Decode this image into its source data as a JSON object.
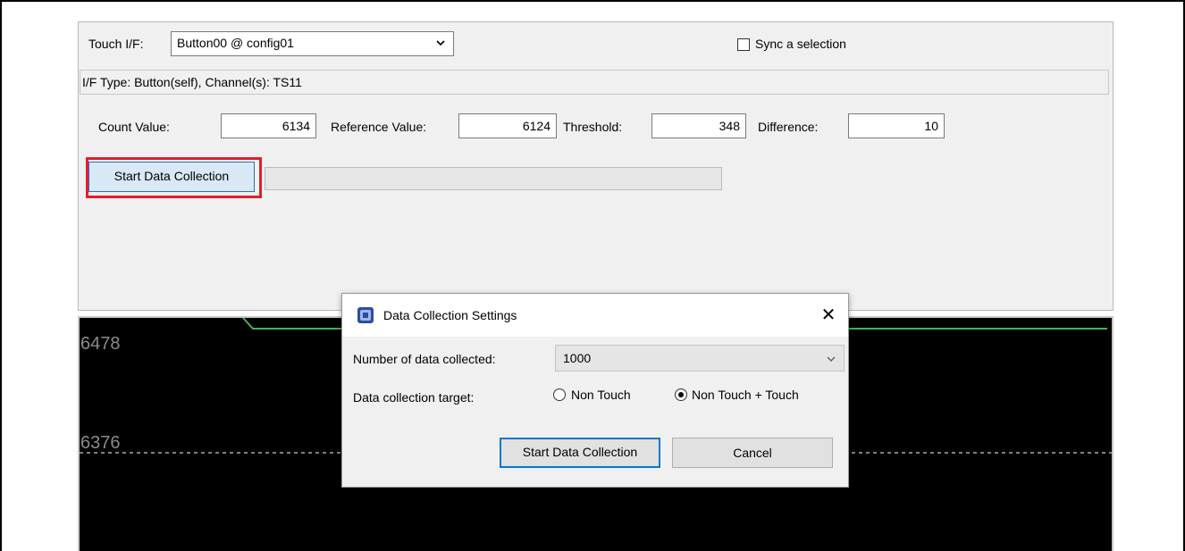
{
  "panel": {
    "touch_if_label": "Touch I/F:",
    "touch_if_value": "Button00 @ config01",
    "sync_label": "Sync a selection",
    "sync_checked": false,
    "if_type_text": "I/F Type: Button(self), Channel(s): TS11",
    "count_label": "Count Value:",
    "count_value": "6134",
    "reference_label": "Reference Value:",
    "reference_value": "6124",
    "threshold_label": "Threshold:",
    "threshold_value": "348",
    "difference_label": "Difference:",
    "difference_value": "10",
    "start_button_label": "Start Data Collection",
    "progress": 0
  },
  "chart": {
    "y_label_top": "6478",
    "y_label_mid": "6376",
    "line_color": "#4caf50",
    "dashed_color": "#ffffff",
    "background": "#000000"
  },
  "dialog": {
    "title": "Data Collection Settings",
    "close_glyph": "✕",
    "number_label": "Number of data collected:",
    "number_value": "1000",
    "target_label": "Data collection target:",
    "option_non_touch": "Non Touch",
    "option_non_touch_plus_touch": "Non Touch + Touch",
    "selected_option": "Non Touch + Touch",
    "start_button_label": "Start Data Collection",
    "cancel_button_label": "Cancel"
  },
  "colors": {
    "highlight": "#e0202a",
    "accent": "#0078d7"
  }
}
